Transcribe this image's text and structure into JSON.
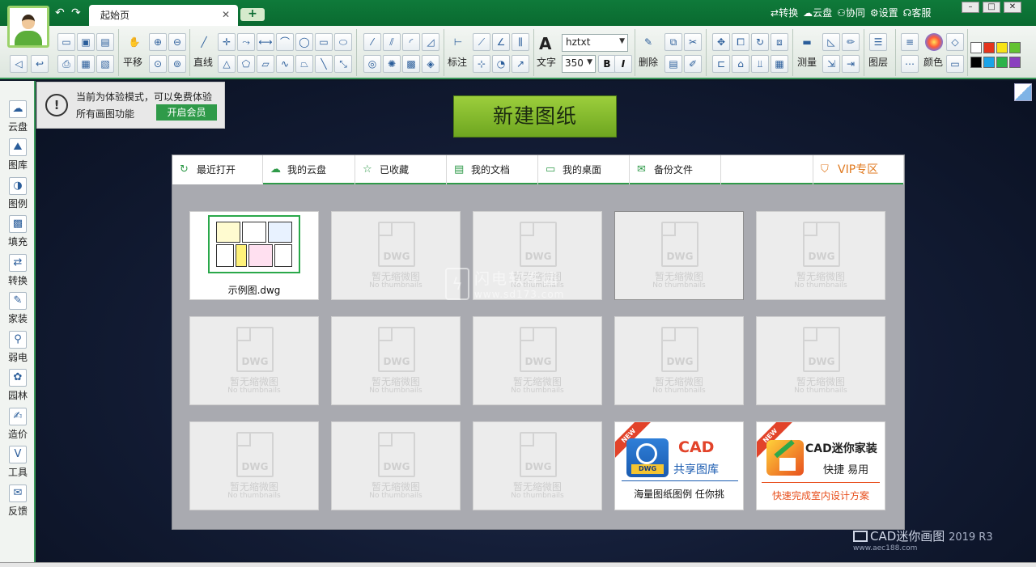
{
  "titlebar": {
    "tab_title": "起始页",
    "tab_close": "✕",
    "add_tab": "+",
    "links": [
      "转换",
      "云盘",
      "协同",
      "设置",
      "客服"
    ],
    "window_buttons": [
      "–",
      "□",
      "✕"
    ]
  },
  "toolbar": {
    "labels": {
      "pan": "平移",
      "line": "直线",
      "dimension": "标注",
      "text": "文字",
      "text_glyph": "A",
      "delete": "删除",
      "measure": "测量",
      "layer": "图层",
      "color": "颜色"
    },
    "font_name": "hztxt",
    "font_size": "350",
    "bold": "B",
    "italic": "I",
    "swatches": [
      "#ffffff",
      "#e5341c",
      "#f7e316",
      "#62c231",
      "#000000",
      "#1aa3e8",
      "#2bb34a",
      "#8a3fbf"
    ]
  },
  "sidebar": {
    "items": [
      "云盘",
      "图库",
      "图例",
      "填充",
      "转换",
      "家装",
      "弱电",
      "园林",
      "造价",
      "工具",
      "反馈"
    ]
  },
  "notice": {
    "icon": "!",
    "line1": "当前为体验模式，可以免费体验",
    "line2": "所有画图功能",
    "button": "开启会员"
  },
  "new_drawing": "新建图纸",
  "tabs": [
    "最近打开",
    "我的云盘",
    "已收藏",
    "我的文档",
    "我的桌面",
    "备份文件"
  ],
  "vip_tab": "VIP专区",
  "sample_file": "示例图.dwg",
  "placeholder": {
    "tag": "DWG",
    "title": "暂无缩微图",
    "subtitle": "No thumbnails"
  },
  "ads": {
    "library": {
      "badge": "NEW",
      "title": "CAD",
      "subtitle": "共享图库",
      "tagline": "海量图纸图例 任你挑",
      "logo_text": "DWG"
    },
    "home": {
      "badge": "NEW",
      "title": "CAD迷你家装",
      "subtitle": "快捷 易用",
      "tagline": "快速完成室内设计方案"
    }
  },
  "watermark": "闪电软件园",
  "watermark_url": "www.sd173.com",
  "brand": {
    "name": "CAD迷你画图",
    "version": "2019 R3",
    "url": "www.aec188.com"
  }
}
